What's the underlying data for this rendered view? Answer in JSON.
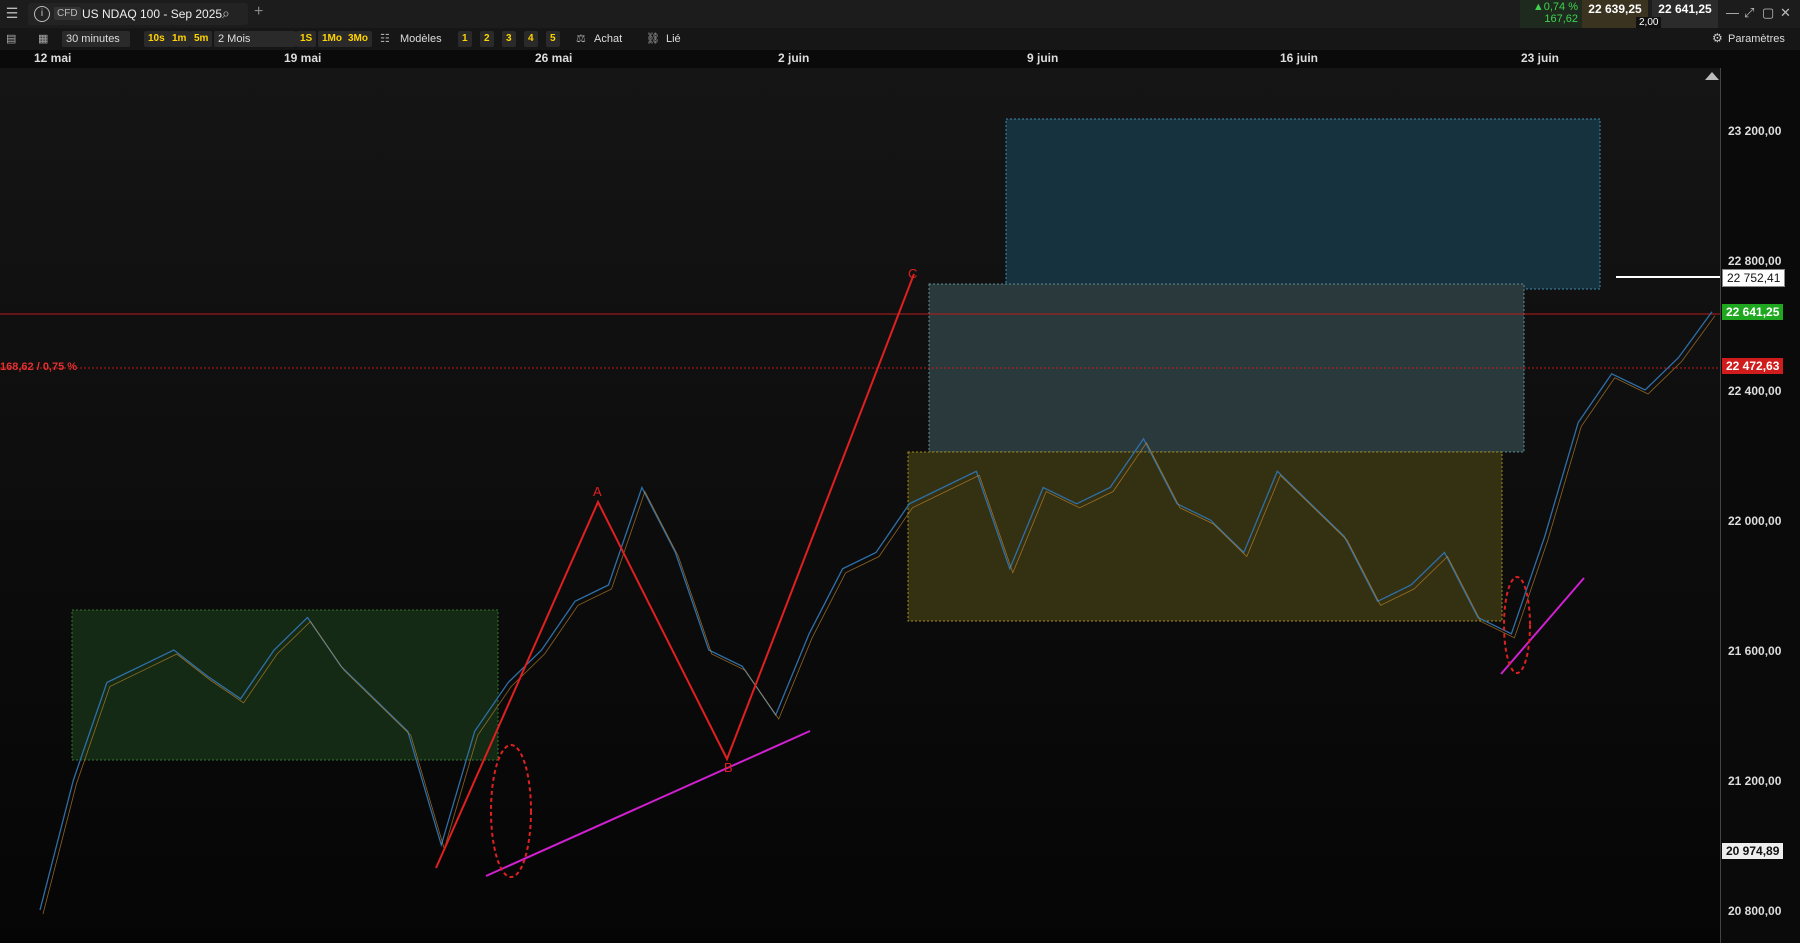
{
  "topbar": {
    "menu_icon": "menu-icon",
    "tab_info": "i",
    "tab_cfd": "CFD",
    "instrument": "US NDAQ 100 - Sep 2025",
    "add_tab": "+",
    "change_pct": "▲0,74 %",
    "change_abs": "167,62",
    "bid": "22 639,25",
    "spread": "2,00",
    "ask": "22 641,25"
  },
  "toolbar": {
    "interval": "30 minutes",
    "quick_intervals": [
      "10s",
      "1m",
      "5m"
    ],
    "range": "2 Mois",
    "quick_ranges": [
      "1S",
      "1Mo",
      "3Mo"
    ],
    "templates": "Modèles",
    "layouts": [
      "1",
      "2",
      "3",
      "4",
      "5"
    ],
    "buy": "Achat",
    "linked": "Lié",
    "settings": "Paramètres"
  },
  "dates": [
    "12 mai",
    "19 mai",
    "26 mai",
    "2 juin",
    "9 juin",
    "16 juin",
    "23 juin"
  ],
  "price_axis": {
    "ticks": [
      "23 200,00",
      "22 800,00",
      "22 400,00",
      "22 000,00",
      "21 600,00",
      "21 200,00",
      "20 800,00"
    ],
    "label_white": "22 752,41",
    "label_current": "22 641,25",
    "label_ref": "22 472,63",
    "label_low": "20 974,89"
  },
  "chart": {
    "ref_line_label": "168,62 / 0,75 %",
    "wave_labels": [
      "A",
      "B",
      "C"
    ],
    "colors": {
      "up": "#2f6fa8",
      "down": "#c98a2c",
      "wave": "#e02020",
      "trend": "#d020d0",
      "current_line": "#b81c1c"
    },
    "chart_data": {
      "type": "line",
      "title": "",
      "x_labels": [
        "12 mai",
        "19 mai",
        "26 mai",
        "2 juin",
        "9 juin",
        "16 juin",
        "23 juin"
      ],
      "series": [
        {
          "values": [
            20800,
            21200,
            21500,
            21550,
            21600,
            21520,
            21450,
            21600,
            21700,
            21550,
            21450,
            21350,
            21000,
            21350,
            21500,
            21600,
            21750,
            21800,
            22100,
            21900,
            21600,
            21550,
            21400,
            21650,
            21850,
            21900,
            22050,
            22100,
            22150,
            21850,
            22100,
            22050,
            22100,
            22250,
            22050,
            22000,
            21900,
            22150,
            22050,
            21950,
            21750,
            21800,
            21900,
            21700,
            21650,
            21950,
            22300,
            22450,
            22400,
            22500,
            22641
          ]
        }
      ],
      "ylim": [
        20700,
        23500
      ]
    }
  }
}
